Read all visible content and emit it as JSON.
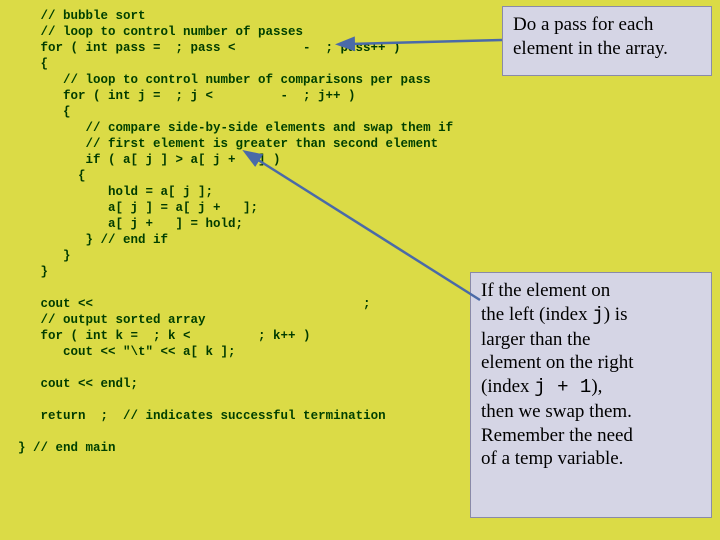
{
  "annot1": {
    "line1": "Do a pass for each",
    "line2": "element in the array."
  },
  "annot2": {
    "p1a": "If the element on",
    "p1b": "the left (index ",
    "j": "j",
    "p1c": ") is",
    "p2": "larger than the",
    "p3": "element on the right",
    "p4a": "(index ",
    "jplus1": "j + 1",
    "p4b": "),",
    "p5": "then we swap them.",
    "p6": "Remember the need",
    "p7": "of a temp variable."
  },
  "code": {
    "l0": "   // bubble sort",
    "l1": "   // loop to control number of passes",
    "l2": "   for ( int pass =  ; pass <         -  ; pass++ )",
    "l3": "   {",
    "l4": "      // loop to control number of comparisons per pass",
    "l5": "      for ( int j =  ; j <         -  ; j++ )",
    "l6": "      {",
    "l7": "         // compare side-by-side elements and swap them if",
    "l8": "         // first element is greater than second element",
    "l9": "         if ( a[ j ] > a[ j +   ] )",
    "l10": "        {",
    "l11": "            hold = a[ j ];",
    "l12": "            a[ j ] = a[ j +   ];",
    "l13": "            a[ j +   ] = hold;",
    "l14": "         } // end if",
    "l15": "      }",
    "l16": "   }",
    "l17": "",
    "l18": "   cout <<                                    ;",
    "l19": "   // output sorted array",
    "l20": "   for ( int k =  ; k <         ; k++ )",
    "l21": "      cout << \"\\t\" << a[ k ];",
    "l22": "",
    "l23": "   cout << endl;",
    "l24": "",
    "l25a": "   return  ; ",
    "l25b": " // indicates successful termination",
    "l26": "",
    "l27": "} // end main"
  }
}
